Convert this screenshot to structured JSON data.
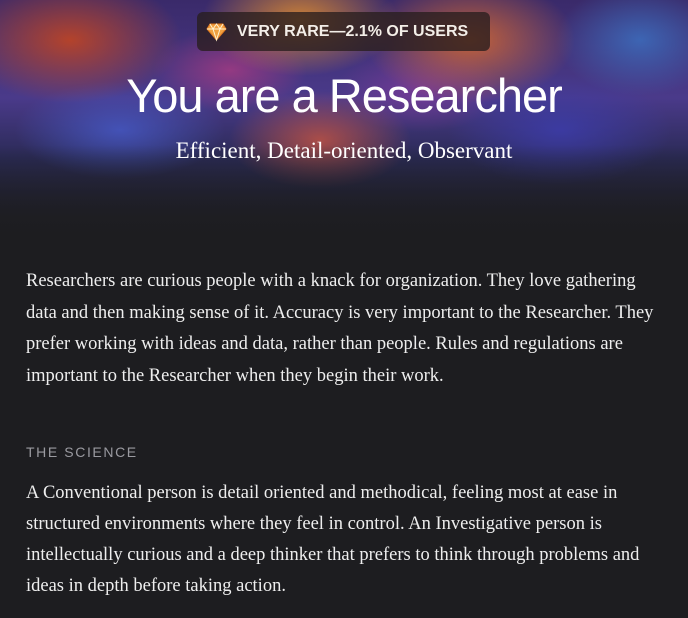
{
  "badge": {
    "icon": "gem-icon",
    "text": "VERY RARE—2.1% OF USERS",
    "icon_color": "#f0a040"
  },
  "header": {
    "title": "You are a Researcher",
    "subtitle": "Efficient, Detail-oriented, Observant"
  },
  "description": "Researchers are curious people with a knack for organization. They love gathering data and then making sense of it. Accuracy is very important to the Researcher. They prefer working with ideas and data, rather than people. Rules and regulations are important to the Researcher when they begin their work.",
  "science": {
    "label": "THE SCIENCE",
    "text": "A Conventional person is detail oriented and methodical, feeling most at ease in structured environments where they feel in control. An Investigative person is intellectually curious and a deep thinker that prefers to think through problems and ideas in depth before taking action."
  },
  "colors": {
    "background": "#1d1d20",
    "text": "#eeeeee",
    "label": "#9a9aa0"
  }
}
